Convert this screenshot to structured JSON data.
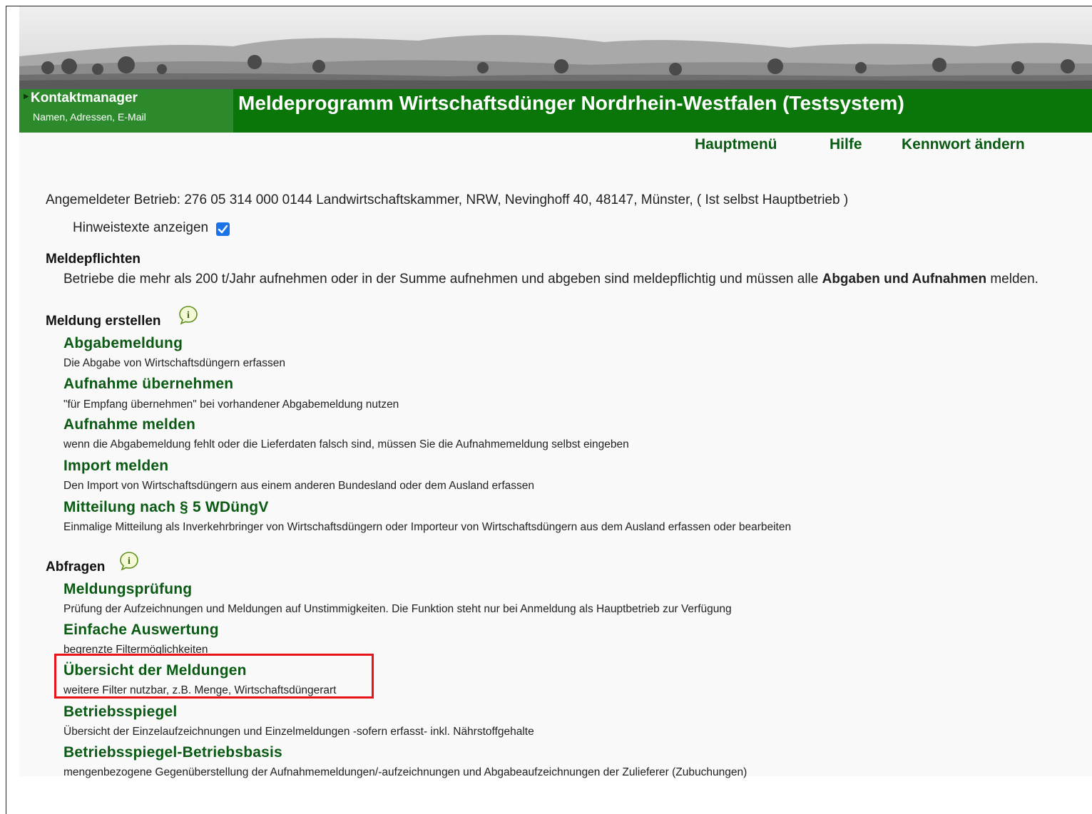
{
  "header": {
    "contact_title": "Kontaktmanager",
    "contact_subtitle": "Namen, Adressen, E-Mail",
    "app_title": "Meldeprogramm Wirtschaftsdünger Nordrhein-Westfalen (Testsystem)"
  },
  "nav": {
    "main_menu": "Hauptmenü",
    "help": "Hilfe",
    "change_password": "Kennwort ändern"
  },
  "login": {
    "text": "Angemeldeter Betrieb: 276 05 314 000 0144 Landwirtschaftskammer, NRW, Nevinghoff 40, 48147, Münster, ( Ist selbst Hauptbetrieb )"
  },
  "hints": {
    "label": "Hinweistexte anzeigen",
    "checked": true
  },
  "duties": {
    "heading": "Meldepflichten",
    "text_before": "Betriebe die mehr als 200 t/Jahr aufnehmen oder in der Summe aufnehmen und abgeben sind meldepflichtig und müssen alle ",
    "text_bold": "Abgaben und Aufnahmen",
    "text_after": " melden."
  },
  "create": {
    "heading": "Meldung erstellen",
    "items": [
      {
        "label": "Abgabemeldung",
        "desc": "Die Abgabe von Wirtschaftsdüngern erfassen"
      },
      {
        "label": "Aufnahme übernehmen",
        "desc": "\"für Empfang übernehmen\" bei vorhandener Abgabemeldung nutzen"
      },
      {
        "label": "Aufnahme melden",
        "desc": "wenn die Abgabemeldung fehlt oder die Lieferdaten falsch sind, müssen Sie die Aufnahmemeldung selbst eingeben"
      },
      {
        "label": "Import melden",
        "desc": "Den Import von Wirtschaftsdüngern aus einem anderen Bundesland oder dem Ausland erfassen"
      },
      {
        "label": "Mitteilung nach § 5 WDüngV",
        "desc": "Einmalige Mitteilung als Inverkehrbringer von Wirtschaftsdüngern oder Importeur von Wirtschaftsdüngern aus dem Ausland erfassen oder bearbeiten"
      }
    ]
  },
  "queries": {
    "heading": "Abfragen",
    "items": [
      {
        "label": "Meldungsprüfung",
        "desc": "Prüfung der Aufzeichnungen und Meldungen auf Unstimmigkeiten. Die Funktion steht nur bei Anmeldung als Hauptbetrieb zur Verfügung"
      },
      {
        "label": "Einfache Auswertung",
        "desc": "begrenzte Filtermöglichkeiten"
      },
      {
        "label": "Übersicht der Meldungen",
        "desc": "weitere Filter nutzbar, z.B. Menge, Wirtschaftsdüngerart"
      },
      {
        "label": "Betriebsspiegel",
        "desc": "Übersicht der Einzelaufzeichnungen und Einzelmeldungen -sofern erfasst- inkl. Nährstoffgehalte"
      },
      {
        "label": "Betriebsspiegel-Betriebsbasis",
        "desc": "mengenbezogene Gegenüberstellung der Aufnahmemeldungen/-aufzeichnungen und Abgabeaufzeichnungen der Zulieferer (Zubuchungen)"
      }
    ]
  },
  "colors": {
    "header_green": "#0a760a",
    "contact_green": "#2c8a2c",
    "link_green": "#0a5a14",
    "highlight_red": "#e8141b",
    "checkbox_blue": "#1a73e8"
  },
  "icons": [
    "info-icon",
    "checkmark-icon",
    "arrow-right-icon"
  ]
}
